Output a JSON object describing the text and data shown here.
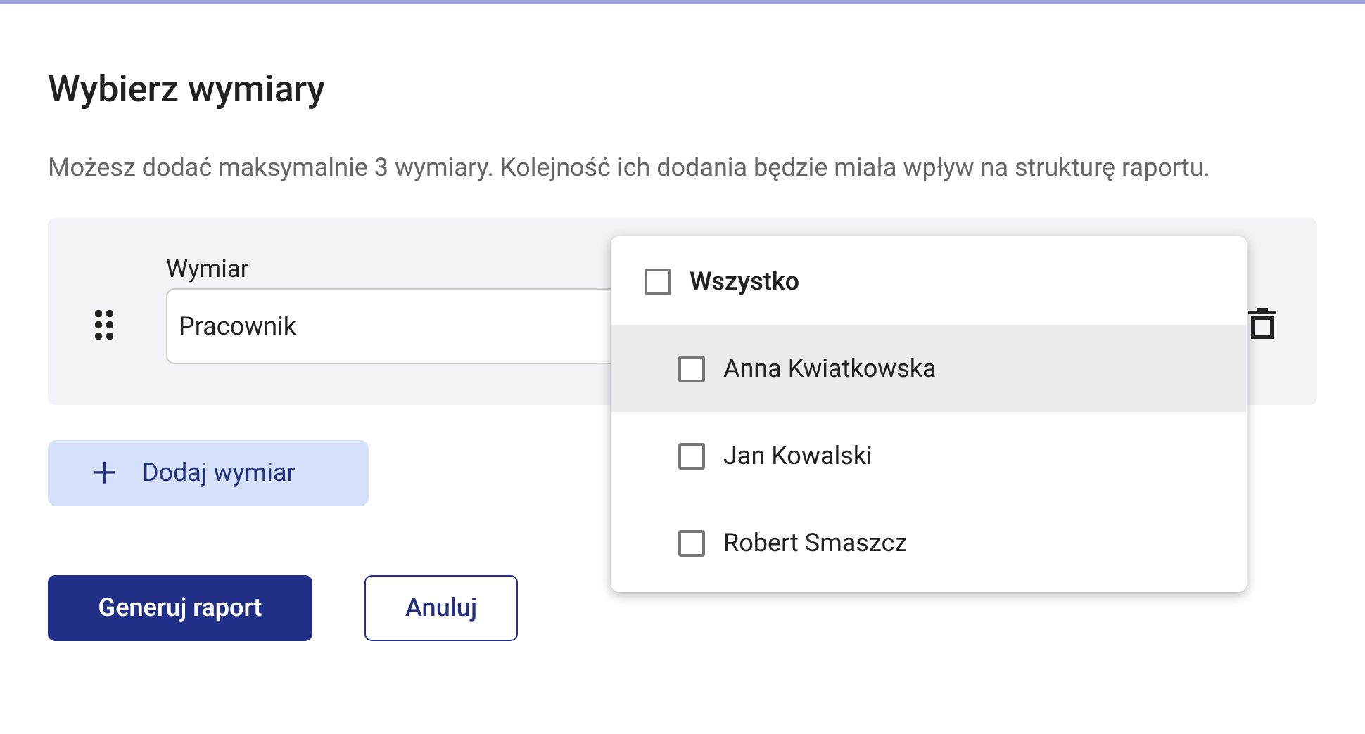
{
  "dialog": {
    "title": "Wybierz wymiary",
    "description": "Możesz dodać maksymalnie 3 wymiary. Kolejność ich dodania będzie miała wpływ na strukturę raportu."
  },
  "dimension_row": {
    "label": "Wymiar",
    "value": "Pracownik"
  },
  "dropdown": {
    "items": [
      {
        "label": "Wszystko",
        "checked": false,
        "hovered": false,
        "children": [
          {
            "label": "Anna Kwiatkowska",
            "checked": false,
            "hovered": true
          },
          {
            "label": "Jan Kowalski",
            "checked": false,
            "hovered": false
          },
          {
            "label": "Robert Smaszcz",
            "checked": false,
            "hovered": false
          }
        ]
      }
    ]
  },
  "add_button": {
    "icon": "+",
    "label": "Dodaj wymiar"
  },
  "buttons": [
    {
      "label": "Generuj raport",
      "kind": "primary"
    },
    {
      "label": "Anuluj",
      "kind": "secondary"
    }
  ]
}
